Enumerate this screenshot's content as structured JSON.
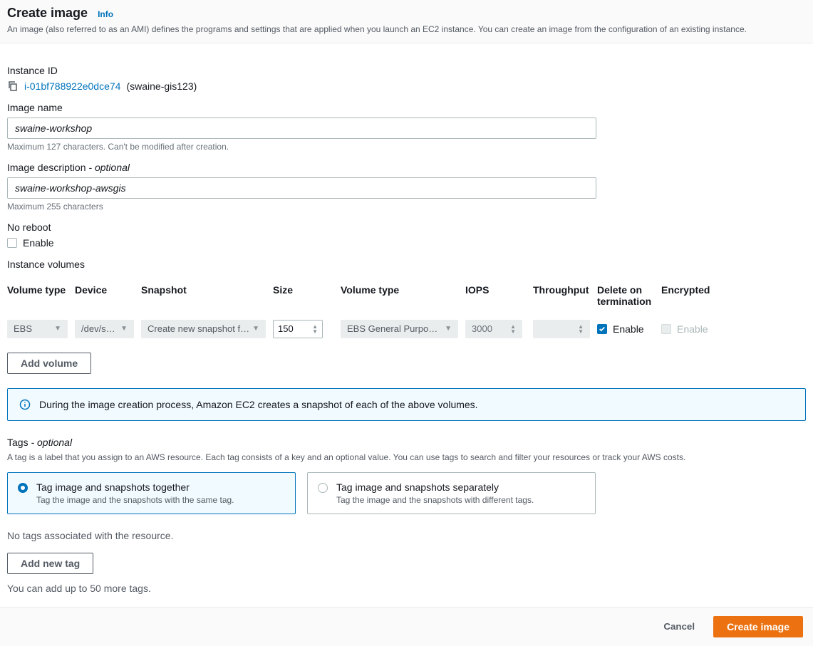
{
  "header": {
    "title": "Create image",
    "info": "Info",
    "description": "An image (also referred to as an AMI) defines the programs and settings that are applied when you launch an EC2 instance. You can create an image from the configuration of an existing instance."
  },
  "instance": {
    "label": "Instance ID",
    "id": "i-01bf788922e0dce74",
    "name": "(swaine-gis123)"
  },
  "image_name": {
    "label": "Image name",
    "value": "swaine-workshop",
    "help": "Maximum 127 characters. Can't be modified after creation."
  },
  "image_desc": {
    "label": "Image description",
    "optional": "- optional",
    "value": "swaine-workshop-awsgis",
    "help": "Maximum 255 characters"
  },
  "no_reboot": {
    "label": "No reboot",
    "enable_label": "Enable"
  },
  "volumes": {
    "label": "Instance volumes",
    "headers": {
      "vtype1": "Volume type",
      "device": "Device",
      "snapshot": "Snapshot",
      "size": "Size",
      "vtype2": "Volume type",
      "iops": "IOPS",
      "throughput": "Throughput",
      "delete": "Delete on termination",
      "encrypted": "Encrypted"
    },
    "row": {
      "vtype1": "EBS",
      "device": "/dev/s…",
      "snapshot": "Create new snapshot fr…",
      "size": "150",
      "vtype2": "EBS General Purpose S…",
      "iops": "3000",
      "throughput": "",
      "delete_label": "Enable",
      "encrypted_label": "Enable"
    },
    "add_button": "Add volume"
  },
  "callout": "During the image creation process, Amazon EC2 creates a snapshot of each of the above volumes.",
  "tags": {
    "label": "Tags",
    "optional": "- optional",
    "desc": "A tag is a label that you assign to an AWS resource. Each tag consists of a key and an optional value. You can use tags to search and filter your resources or track your AWS costs.",
    "opt1_title": "Tag image and snapshots together",
    "opt1_sub": "Tag the image and the snapshots with the same tag.",
    "opt2_title": "Tag image and snapshots separately",
    "opt2_sub": "Tag the image and the snapshots with different tags.",
    "no_tags": "No tags associated with the resource.",
    "add_button": "Add new tag",
    "limit": "You can add up to 50 more tags."
  },
  "footer": {
    "cancel": "Cancel",
    "create": "Create image"
  }
}
